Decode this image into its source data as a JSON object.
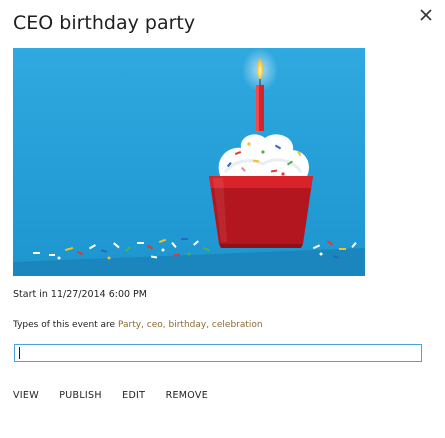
{
  "dialog": {
    "title": "CEO birthday party",
    "close_icon": "close-icon"
  },
  "event": {
    "start_prefix": "Start in",
    "start_datetime": "11/27/2014 6:00 PM",
    "types_prefix": "Types of this event are",
    "tags": "Party, ceo, birthday, celebration",
    "image_subject": "birthday cupcake with lit candle on blue background"
  },
  "input": {
    "value": "",
    "placeholder": ""
  },
  "actions": [
    "VIEW",
    "PUBLISH",
    "EDIT",
    "REMOVE"
  ],
  "colors": {
    "image_background": "#2aa4dc",
    "input_border": "#4aa3df",
    "tag_text": "#8a6a33",
    "title_text": "#1f1f1f"
  }
}
